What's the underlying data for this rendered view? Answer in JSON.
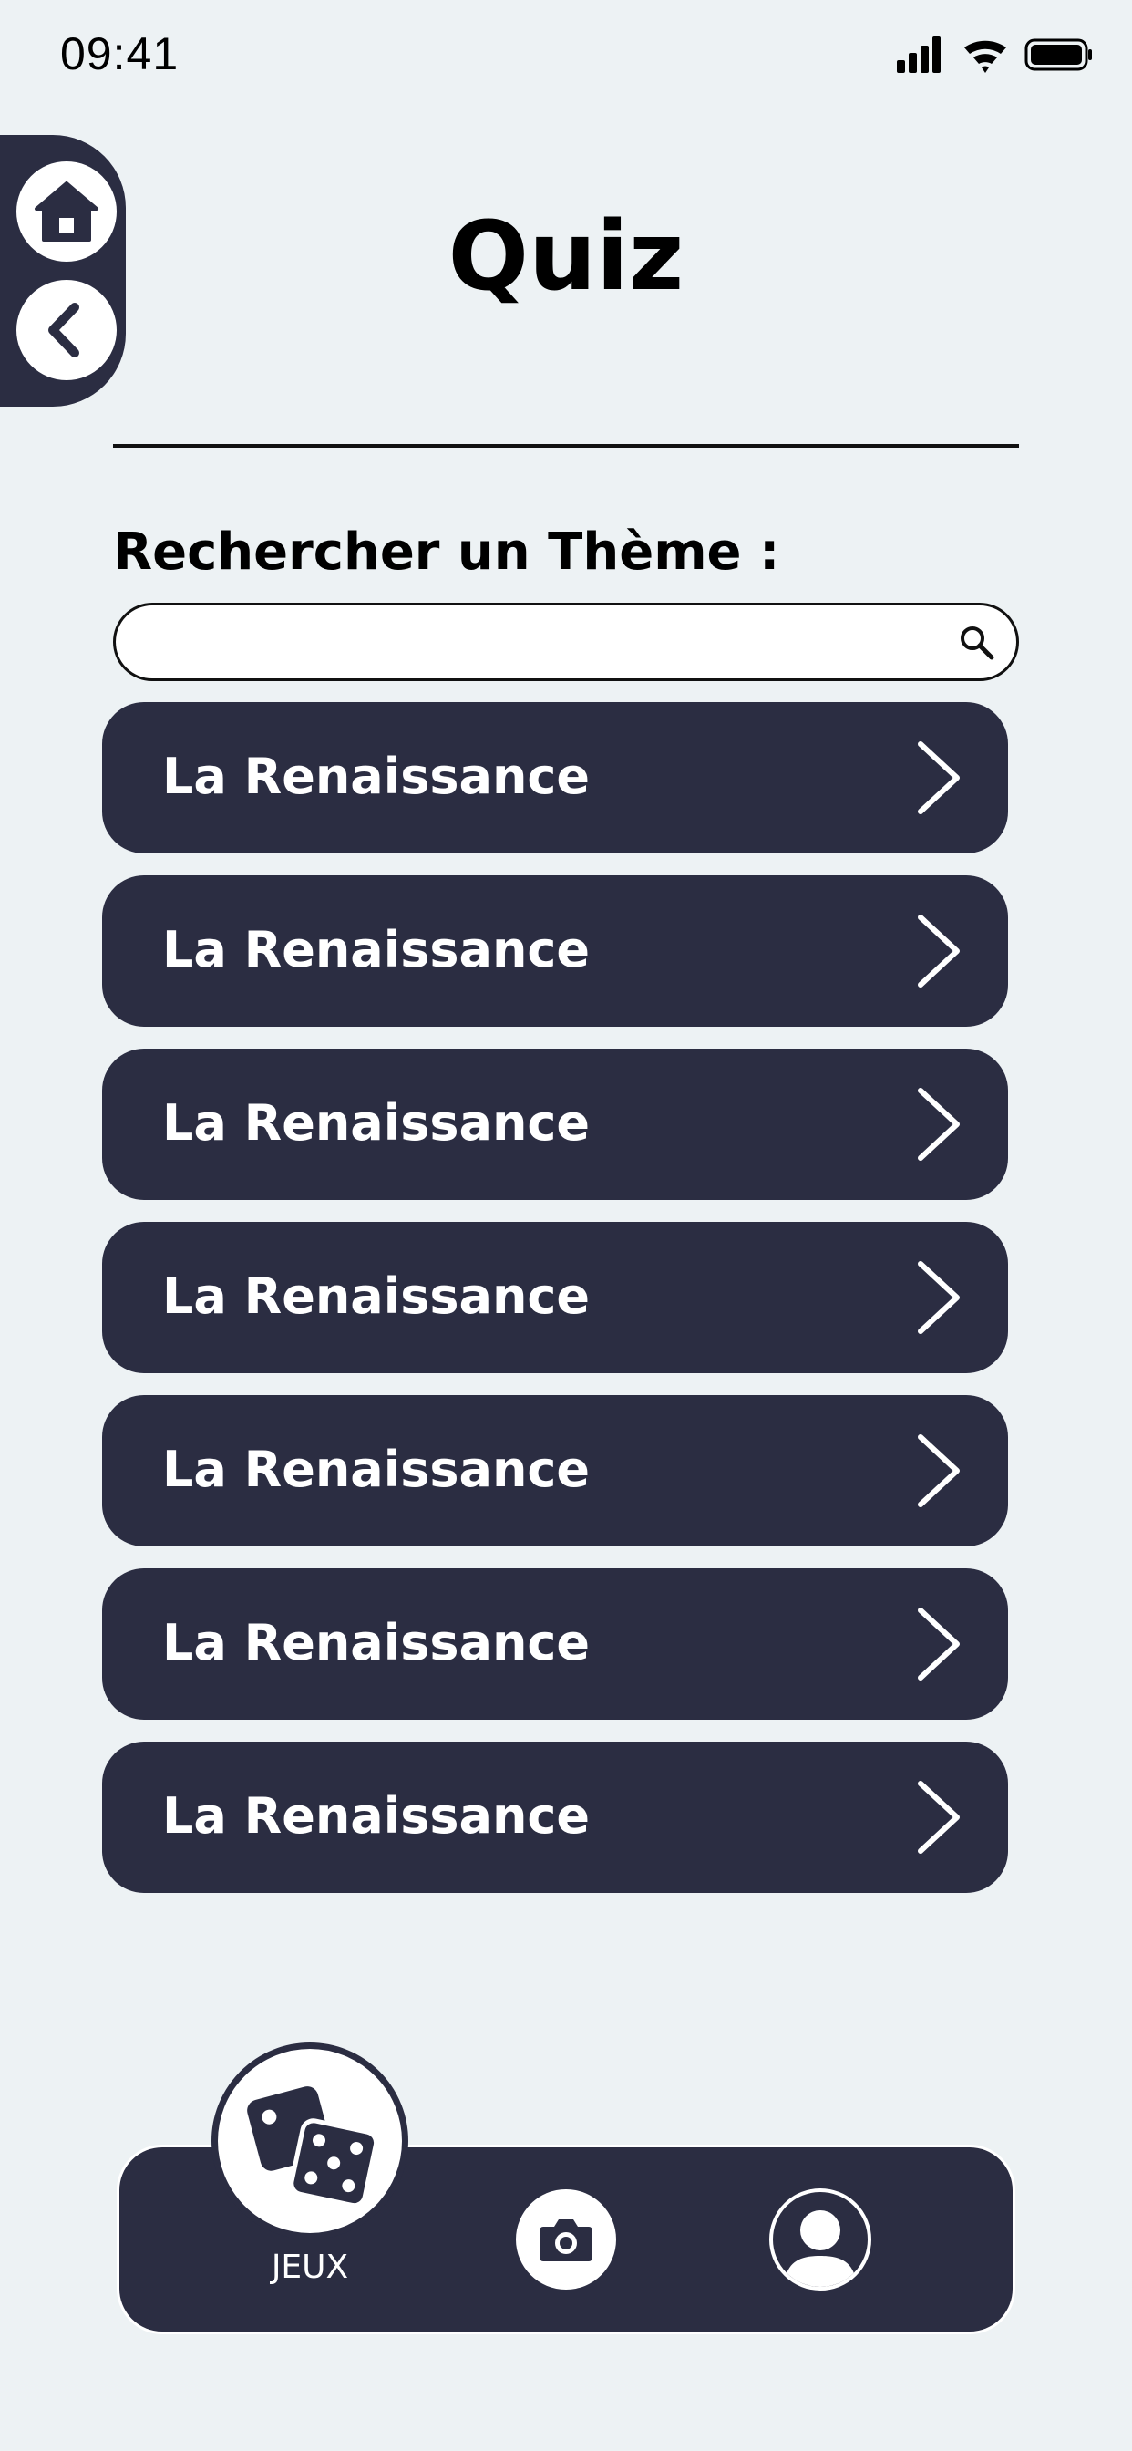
{
  "status_bar": {
    "time": "09:41",
    "icons": [
      "signal-icon",
      "wifi-icon",
      "battery-icon"
    ]
  },
  "side_nav": {
    "icons": [
      "home-icon",
      "back-arrow-icon"
    ]
  },
  "header": {
    "title": "Quiz"
  },
  "search": {
    "label": "Rechercher un Thème :",
    "value": "",
    "placeholder": ""
  },
  "themes": [
    {
      "label": "La Renaissance"
    },
    {
      "label": "La Renaissance"
    },
    {
      "label": "La Renaissance"
    },
    {
      "label": "La Renaissance"
    },
    {
      "label": "La Renaissance"
    },
    {
      "label": "La Renaissance"
    },
    {
      "label": "La Renaissance"
    }
  ],
  "bottom_nav": {
    "games_label": "JEUX",
    "icons": [
      "dice-icon",
      "camera-icon",
      "profile-icon"
    ]
  },
  "colors": {
    "background": "#edf2f4",
    "primary_dark": "#2b2d42",
    "white": "#ffffff"
  }
}
